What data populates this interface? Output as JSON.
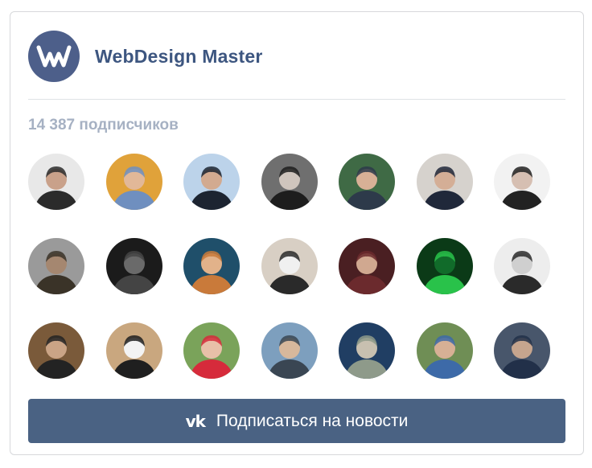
{
  "group": {
    "name": "WebDesign Master",
    "logo_icon": "wm-logo-icon",
    "subscribers_text": "14 387 подписчиков"
  },
  "subscribe_button": {
    "icon": "vk-icon",
    "icon_text": "vk",
    "label": "Подписаться на новости"
  },
  "colors": {
    "brand": "#4d5f8a",
    "title": "#3d5680",
    "muted": "#a6b1c3",
    "button": "#4a6283"
  },
  "avatars": [
    {
      "bg": "#e8e8e8",
      "fg": "#2b2b2b",
      "skin": "#c9a18a"
    },
    {
      "bg": "#e0a23a",
      "fg": "#6f8fbf",
      "skin": "#e2b898"
    },
    {
      "bg": "#bcd3ea",
      "fg": "#1c2431",
      "skin": "#d2aa90"
    },
    {
      "bg": "#6f6f6f",
      "fg": "#1d1d1d",
      "skin": "#cfc5bd"
    },
    {
      "bg": "#3f6a45",
      "fg": "#2d3a4a",
      "skin": "#d8b096"
    },
    {
      "bg": "#d6d2cd",
      "fg": "#20283a",
      "skin": "#d4ae96"
    },
    {
      "bg": "#f2f2f2",
      "fg": "#222222",
      "skin": "#d6bfb2"
    },
    {
      "bg": "#9a9a9a",
      "fg": "#3a3328",
      "skin": "#a58770"
    },
    {
      "bg": "#1b1b1b",
      "fg": "#444444",
      "skin": "#6a6a6a"
    },
    {
      "bg": "#1f4f6a",
      "fg": "#c97a3a",
      "skin": "#e2b28a"
    },
    {
      "bg": "#d8cfc4",
      "fg": "#2a2a2a",
      "skin": "#f0f0f0"
    },
    {
      "bg": "#4a1f22",
      "fg": "#6b2a2d",
      "skin": "#d0a890"
    },
    {
      "bg": "#0b3a17",
      "fg": "#29c24a",
      "skin": "#116b2a"
    },
    {
      "bg": "#ededed",
      "fg": "#2a2a2a",
      "skin": "#cfcfcf"
    },
    {
      "bg": "#7a5a3a",
      "fg": "#232323",
      "skin": "#caa486"
    },
    {
      "bg": "#c9a77f",
      "fg": "#1f1f1f",
      "skin": "#f3f3f3"
    },
    {
      "bg": "#7aa35a",
      "fg": "#d62b3b",
      "skin": "#e8c0a8"
    },
    {
      "bg": "#7d9fbe",
      "fg": "#3a4653",
      "skin": "#d7b89c"
    },
    {
      "bg": "#203e63",
      "fg": "#8e9a8a",
      "skin": "#c8c0b0"
    },
    {
      "bg": "#6f8e55",
      "fg": "#3d6aa8",
      "skin": "#d7b095"
    },
    {
      "bg": "#48566b",
      "fg": "#223049",
      "skin": "#c6a58e"
    }
  ]
}
